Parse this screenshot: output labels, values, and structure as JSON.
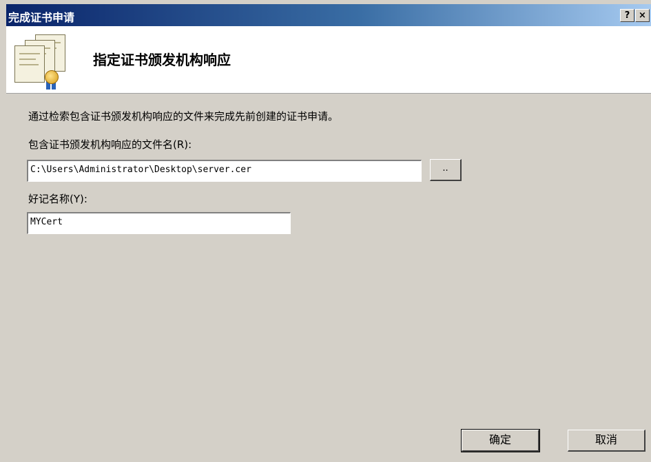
{
  "window": {
    "title": "完成证书申请",
    "help_label": "?",
    "close_label": "×"
  },
  "header": {
    "title": "指定证书颁发机构响应",
    "icon": "certificate-icon"
  },
  "main": {
    "description": "通过检索包含证书颁发机构响应的文件来完成先前创建的证书申请。",
    "file_label": "包含证书颁发机构响应的文件名(R):",
    "file_value": "C:\\Users\\Administrator\\Desktop\\server.cer",
    "browse_label": "..",
    "friendly_label": "好记名称(Y):",
    "friendly_value": "MYCert"
  },
  "buttons": {
    "ok": "确定",
    "cancel": "取消"
  }
}
